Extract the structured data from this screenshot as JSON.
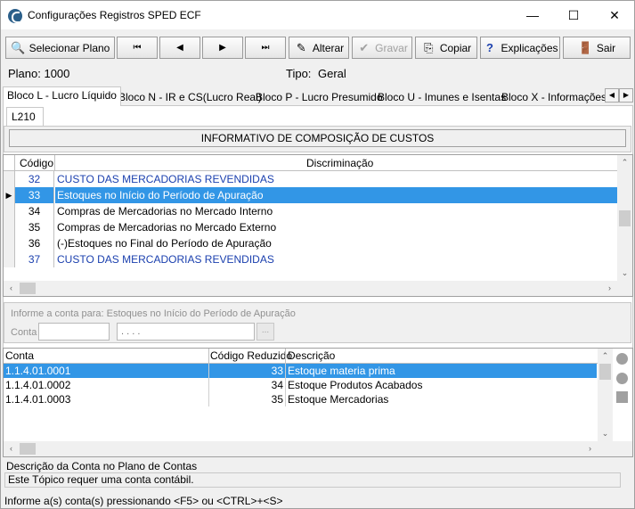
{
  "window": {
    "title": "Configurações Registros SPED ECF",
    "minimize": "—",
    "maximize": "☐",
    "close": "✕"
  },
  "toolbar": {
    "selecionar_plano": "Selecionar Plano",
    "first": "⏮",
    "prev": "◀",
    "next": "▶",
    "last": "⏭",
    "alterar": "Alterar",
    "gravar": "Gravar",
    "copiar": "Copiar",
    "explicacoes": "Explicações",
    "sair": "Sair"
  },
  "info": {
    "plano_label": "Plano: 1000",
    "tipo_label": "Tipo:",
    "tipo_value": "Geral"
  },
  "tabs": [
    {
      "label": "Bloco L - Lucro Líquido"
    },
    {
      "label": "Bloco N - IR e CS(Lucro Real)"
    },
    {
      "label": "Bloco P - Lucro Presumido"
    },
    {
      "label": "Bloco U - Imunes e Isentas"
    },
    {
      "label": "Bloco X - Informações E"
    }
  ],
  "subtab": "L210",
  "section_heading": "INFORMATIVO DE COMPOSIÇÃO DE CUSTOS",
  "grid1": {
    "columns": [
      "Código",
      "Discriminação"
    ],
    "rows": [
      {
        "code": "32",
        "desc": "CUSTO DAS MERCADORIAS REVENDIDAS",
        "style": "blue"
      },
      {
        "code": "33",
        "desc": "Estoques no Início do Período de Apuração",
        "style": "selected"
      },
      {
        "code": "34",
        "desc": "Compras de Mercadorias no Mercado Interno",
        "style": "normal"
      },
      {
        "code": "35",
        "desc": "Compras de Mercadorias no Mercado Externo",
        "style": "normal"
      },
      {
        "code": "36",
        "desc": "(-)Estoques no Final do Período de Apuração",
        "style": "normal"
      },
      {
        "code": "37",
        "desc": "CUSTO DAS MERCADORIAS REVENDIDAS",
        "style": "blue"
      }
    ]
  },
  "account_prompt": {
    "label": "Informe a conta para: Estoques no Início do Período de Apuração",
    "conta_label": "Conta",
    "conta_value": "",
    "mask_value": ". . . .",
    "ellipsis": "..."
  },
  "grid2": {
    "columns": [
      "Conta",
      "Código Reduzido",
      "Descrição"
    ],
    "rows": [
      {
        "conta": "1.1.4.01.0001",
        "codigo": "33",
        "descricao": "Estoque materia prima"
      },
      {
        "conta": "1.1.4.01.0002",
        "codigo": "34",
        "descricao": "Estoque Produtos Acabados"
      },
      {
        "conta": "1.1.4.01.0003",
        "codigo": "35",
        "descricao": "Estoque Mercadorias"
      }
    ]
  },
  "status": {
    "line1": "Descrição da Conta no Plano de Contas",
    "line2": "Este Tópico requer uma conta contábil.",
    "hint": "Informe a(s) conta(s) pressionando <F5> ou <CTRL>+<S>"
  },
  "colors": {
    "selection": "#3296e6",
    "header_blue_text": "#1a3fae"
  }
}
